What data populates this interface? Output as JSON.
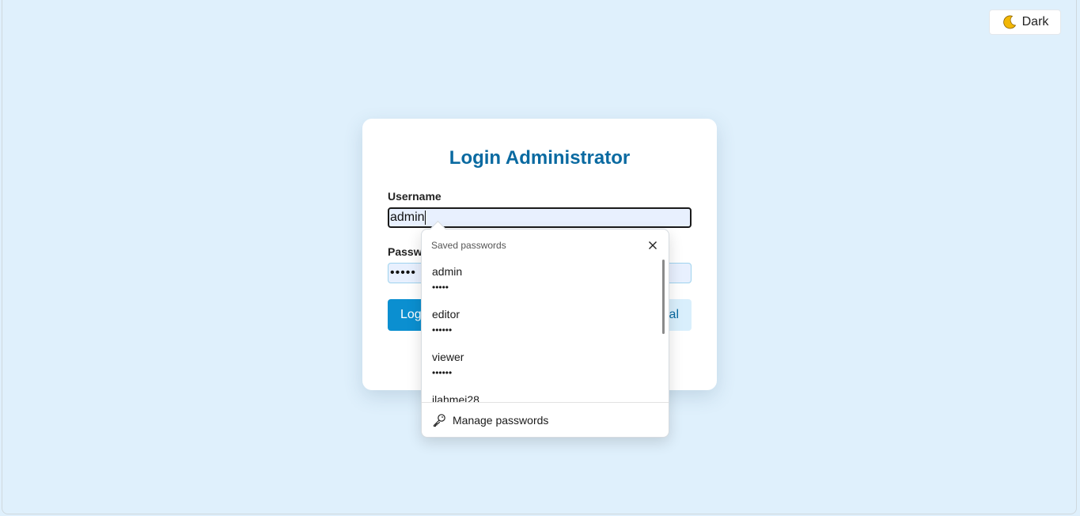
{
  "theme_toggle": {
    "icon": "moon-icon",
    "label": "Dark"
  },
  "login_card": {
    "title": "Login Administrator",
    "username_label": "Username",
    "username_value": "admin",
    "password_label": "Passwo",
    "password_value": "•••••",
    "login_button": "Log",
    "cancel_button": "al"
  },
  "autofill_dropdown": {
    "header": "Saved passwords",
    "close_icon": "close-icon",
    "items": [
      {
        "username": "admin",
        "password": "•••••"
      },
      {
        "username": "editor",
        "password": "••••••"
      },
      {
        "username": "viewer",
        "password": "••••••"
      },
      {
        "username": "ilahmei28",
        "password": ""
      }
    ],
    "manage_label": "Manage passwords",
    "manage_icon": "key-icon"
  },
  "colors": {
    "background": "#dff0fc",
    "title": "#0a6aa1",
    "primary_button": "#0b8fd0",
    "secondary_button": "#d9effc",
    "input_fill": "#e8f0fe"
  }
}
